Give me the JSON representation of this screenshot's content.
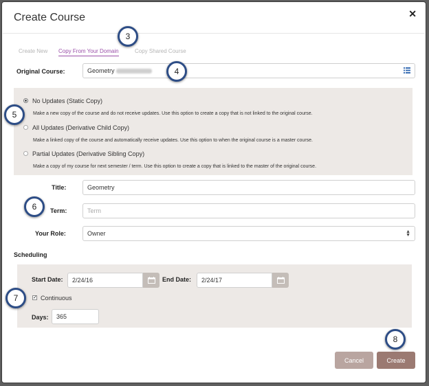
{
  "dialog": {
    "title": "Create Course",
    "close_icon": "close-icon"
  },
  "tabs": [
    {
      "label": "Create New",
      "active": false
    },
    {
      "label": "Copy From Your Domain",
      "active": true
    },
    {
      "label": "Copy Shared Course",
      "active": false
    }
  ],
  "original_course": {
    "label": "Original Course:",
    "value": "Geometry",
    "browse_icon": "list-grid-icon"
  },
  "copy_options": [
    {
      "label": "No Updates (Static Copy)",
      "selected": true,
      "description": "Make a new copy of the course and do not receive updates. Use this option to create a copy that is not linked to the original course."
    },
    {
      "label": "All Updates (Derivative Child Copy)",
      "selected": false,
      "description": "Make a linked copy of the course and automatically receive updates. Use this option to when the original course is a master course."
    },
    {
      "label": "Partial Updates (Derivative Sibling Copy)",
      "selected": false,
      "description": "Make a copy of my course for next semester / term. Use this option to create a copy that is linked to the master of the original course."
    }
  ],
  "form": {
    "title_label": "Title:",
    "title_value": "Geometry",
    "term_label": "Term:",
    "term_placeholder": "Term",
    "role_label": "Your Role:",
    "role_value": "Owner"
  },
  "scheduling": {
    "heading": "Scheduling",
    "start_label": "Start Date:",
    "start_value": "2/24/16",
    "end_label": "End Date:",
    "end_value": "2/24/17",
    "continuous_label": "Continuous",
    "continuous_checked": true,
    "days_label": "Days:",
    "days_value": "365",
    "calendar_icon": "calendar-icon"
  },
  "buttons": {
    "cancel": "Cancel",
    "create": "Create"
  },
  "callouts": [
    "3",
    "4",
    "5",
    "6",
    "7",
    "8"
  ],
  "colors": {
    "accent": "#9a4fa8",
    "callout_border": "#2d4d86",
    "create_button": "#9b7a72",
    "cancel_button": "#b9a5a0",
    "panel": "#ede9e6"
  }
}
